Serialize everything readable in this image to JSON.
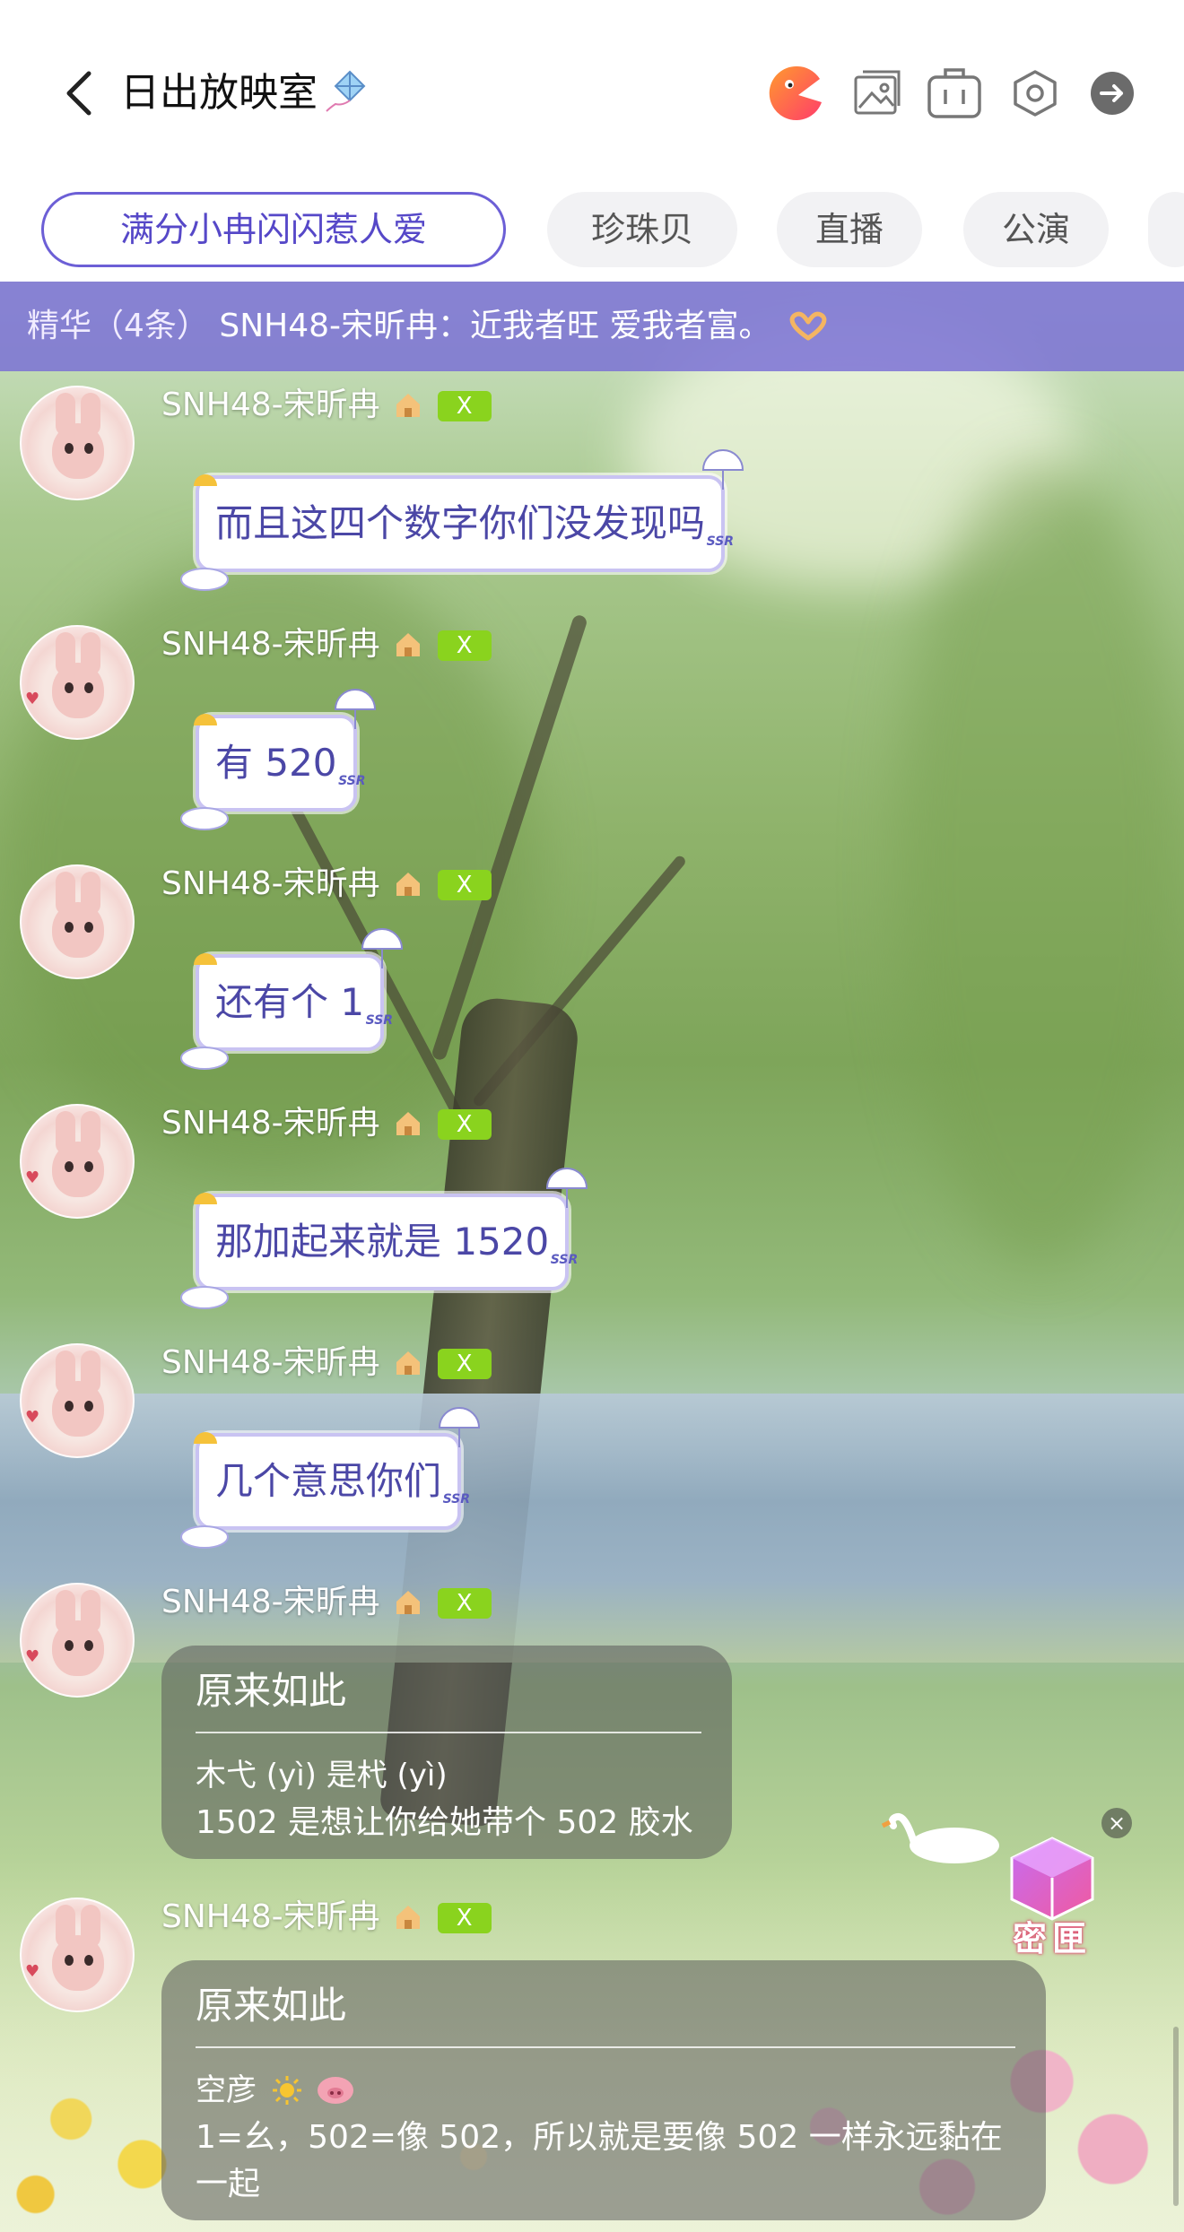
{
  "header": {
    "title": "日出放映室",
    "icons": [
      "back-icon",
      "kite-icon",
      "game-mascot-icon",
      "image-icon",
      "suitcase-icon",
      "hexagon-settings-icon",
      "exit-arrow-icon"
    ]
  },
  "tabs": [
    {
      "label": "满分小冉闪闪惹人爱",
      "active": true
    },
    {
      "label": "珍珠贝",
      "active": false
    },
    {
      "label": "直播",
      "active": false
    },
    {
      "label": "公演",
      "active": false
    }
  ],
  "pinned": {
    "prefix": "精华（4条）",
    "text": "SNH48-宋昕冉：近我者旺 爱我者富。"
  },
  "messages": [
    {
      "sender": "SNH48-宋昕冉",
      "badge": "X",
      "text": "而且这四个数字你们没发现吗"
    },
    {
      "sender": "SNH48-宋昕冉",
      "badge": "X",
      "text": "有 520"
    },
    {
      "sender": "SNH48-宋昕冉",
      "badge": "X",
      "text": "还有个 1"
    },
    {
      "sender": "SNH48-宋昕冉",
      "badge": "X",
      "text": "那加起来就是 1520"
    },
    {
      "sender": "SNH48-宋昕冉",
      "badge": "X",
      "text": "几个意思你们"
    },
    {
      "sender": "SNH48-宋昕冉",
      "badge": "X",
      "text": "原来如此",
      "quote_name": "木弋 (yì) 是杙 (yì)",
      "quote_text": "1502 是想让你给她带个 502 胶水"
    },
    {
      "sender": "SNH48-宋昕冉",
      "badge": "X",
      "text": "原来如此",
      "quote_name": "空彦",
      "quote_text": "1=幺，502=像 502，所以就是要像 502 一样永远黏在一起"
    }
  ],
  "widget": {
    "label": "密匣",
    "close": "×"
  },
  "colors": {
    "accent": "#6c5fd6",
    "pinned_bg": "#786cd6",
    "badge_green": "#8ad31e",
    "bubble_text": "#4b47a6"
  }
}
